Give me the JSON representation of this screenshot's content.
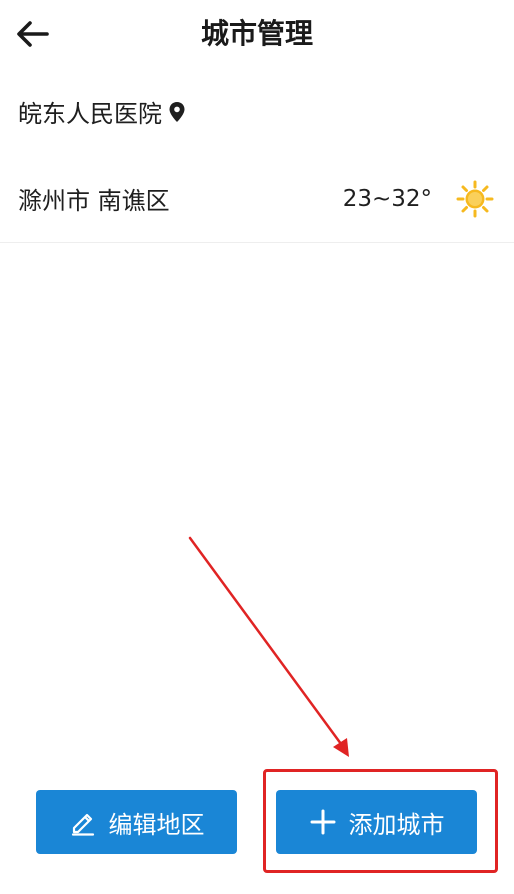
{
  "header": {
    "title": "城市管理",
    "back_icon": "arrow-left-icon"
  },
  "cities": [
    {
      "label": "皖东人民医院",
      "icon": "location-pin-icon"
    },
    {
      "label": "滁州市 南谯区",
      "temperature": "23~32°",
      "weather_icon": "sun-icon"
    }
  ],
  "buttons": {
    "edit_label": "编辑地区",
    "edit_icon": "pencil-icon",
    "add_label": "添加城市",
    "add_icon": "plus-icon"
  },
  "colors": {
    "accent": "#1a86d6",
    "highlight": "#e02424",
    "sun": "#f6b91f"
  }
}
